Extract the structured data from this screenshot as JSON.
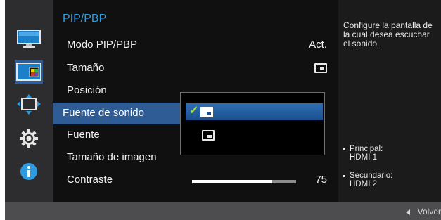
{
  "sidebar": {
    "icons": [
      "monitor-icon",
      "pip-color-icon",
      "move-arrows-icon",
      "gear-icon",
      "info-icon"
    ]
  },
  "menu": {
    "title": "PIP/PBP",
    "items": [
      {
        "label": "Modo PIP/PBP",
        "value": "Act."
      },
      {
        "label": "Tamaño",
        "value_icon": "pip-size-icon"
      },
      {
        "label": "Posición"
      },
      {
        "label": "Fuente de sonido",
        "selected": true
      },
      {
        "label": "Fuente"
      },
      {
        "label": "Tamaño de imagen"
      },
      {
        "label": "Contraste",
        "value": "75",
        "level": 0.77
      }
    ]
  },
  "popup": {
    "options": [
      {
        "icon": "main-screen-audio-icon",
        "checked": true
      },
      {
        "icon": "sub-screen-audio-icon",
        "checked": false
      }
    ]
  },
  "info": {
    "description": "Configure la pantalla de la cual desea escuchar el sonido.",
    "principal_label": "Principal:",
    "principal_value": "HDMI 1",
    "secundario_label": "Secundario:",
    "secundario_value": "HDMI 2"
  },
  "footer": {
    "back_label": "Volver"
  },
  "colors": {
    "accent": "#2d9be0",
    "selection": "#2f5c94",
    "check": "#a8e03a"
  }
}
